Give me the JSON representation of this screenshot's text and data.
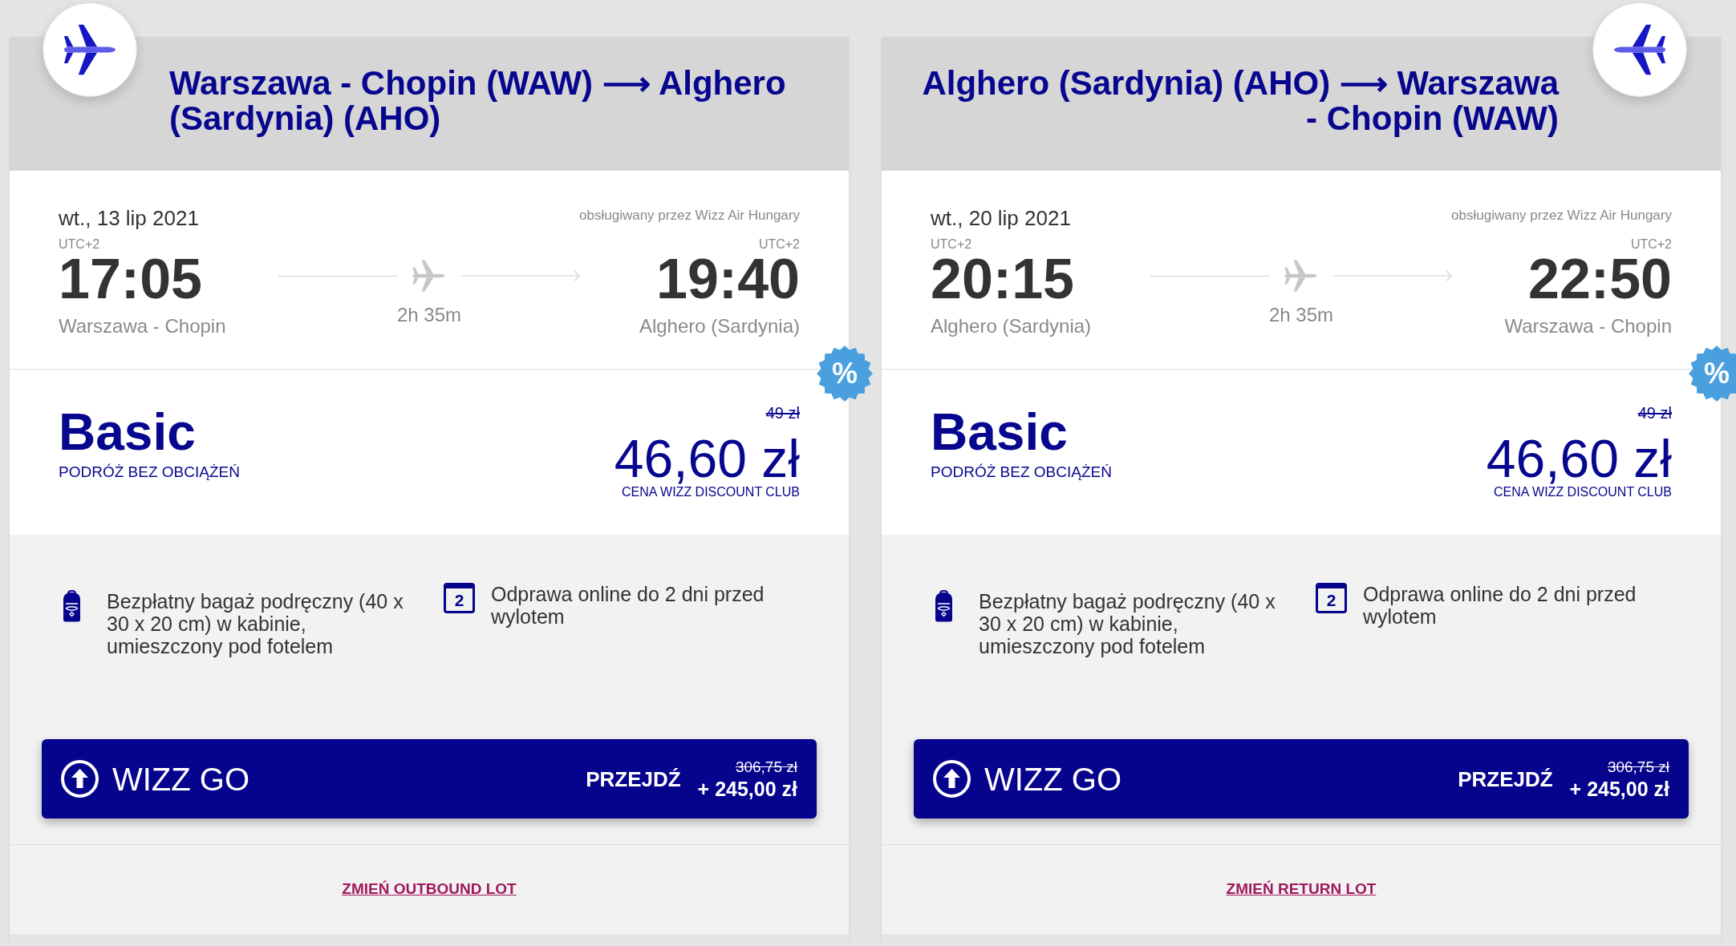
{
  "cards": [
    {
      "kind": "outbound",
      "title": "Warszawa - Chopin (WAW) ⟶ Alghero (Sardynia) (AHO)",
      "flight": {
        "date": "wt., 13 lip 2021",
        "operator": "obsługiwany przez Wizz Air Hungary",
        "departure": {
          "timezone": "UTC+2",
          "time": "17:05",
          "airport": "Warszawa - Chopin"
        },
        "duration": "2h 35m",
        "arrival": {
          "timezone": "UTC+2",
          "time": "19:40",
          "airport": "Alghero (Sardynia)"
        }
      },
      "fare": {
        "discount_badge": "%",
        "name": "Basic",
        "subtitle": "PODRÓŻ BEZ OBCIĄŻEŃ",
        "old_price": "49 zł",
        "price": "46,60 zł",
        "price_note": "CENA WIZZ DISCOUNT CLUB"
      },
      "features": [
        {
          "kind": "bag",
          "text": "Bezpłatny bagaż podręczny (40 x 30 x 20 cm) w kabinie, umieszczony pod fotelem"
        },
        {
          "kind": "calendar",
          "icon_text": "2",
          "text": "Odprawa online do 2 dni przed wylotem"
        }
      ],
      "upgrade": {
        "label": "WIZZ GO",
        "action": "PRZEJDŹ",
        "old_price": "306,75 zł",
        "price": "+ 245,00 zł"
      },
      "change_link": "ZMIEŃ OUTBOUND LOT"
    },
    {
      "kind": "return",
      "title": "Alghero (Sardynia) (AHO) ⟶ Warszawa - Chopin (WAW)",
      "flight": {
        "date": "wt., 20 lip 2021",
        "operator": "obsługiwany przez Wizz Air Hungary",
        "departure": {
          "timezone": "UTC+2",
          "time": "20:15",
          "airport": "Alghero (Sardynia)"
        },
        "duration": "2h 35m",
        "arrival": {
          "timezone": "UTC+2",
          "time": "22:50",
          "airport": "Warszawa - Chopin"
        }
      },
      "fare": {
        "discount_badge": "%",
        "name": "Basic",
        "subtitle": "PODRÓŻ BEZ OBCIĄŻEŃ",
        "old_price": "49 zł",
        "price": "46,60 zł",
        "price_note": "CENA WIZZ DISCOUNT CLUB"
      },
      "features": [
        {
          "kind": "bag",
          "text": "Bezpłatny bagaż podręczny (40 x 30 x 20 cm) w kabinie, umieszczony pod fotelem"
        },
        {
          "kind": "calendar",
          "icon_text": "2",
          "text": "Odprawa online do 2 dni przed wylotem"
        }
      ],
      "upgrade": {
        "label": "WIZZ GO",
        "action": "PRZEJDŹ",
        "old_price": "306,75 zł",
        "price": "+ 245,00 zł"
      },
      "change_link": "ZMIEŃ RETURN LOT"
    }
  ]
}
